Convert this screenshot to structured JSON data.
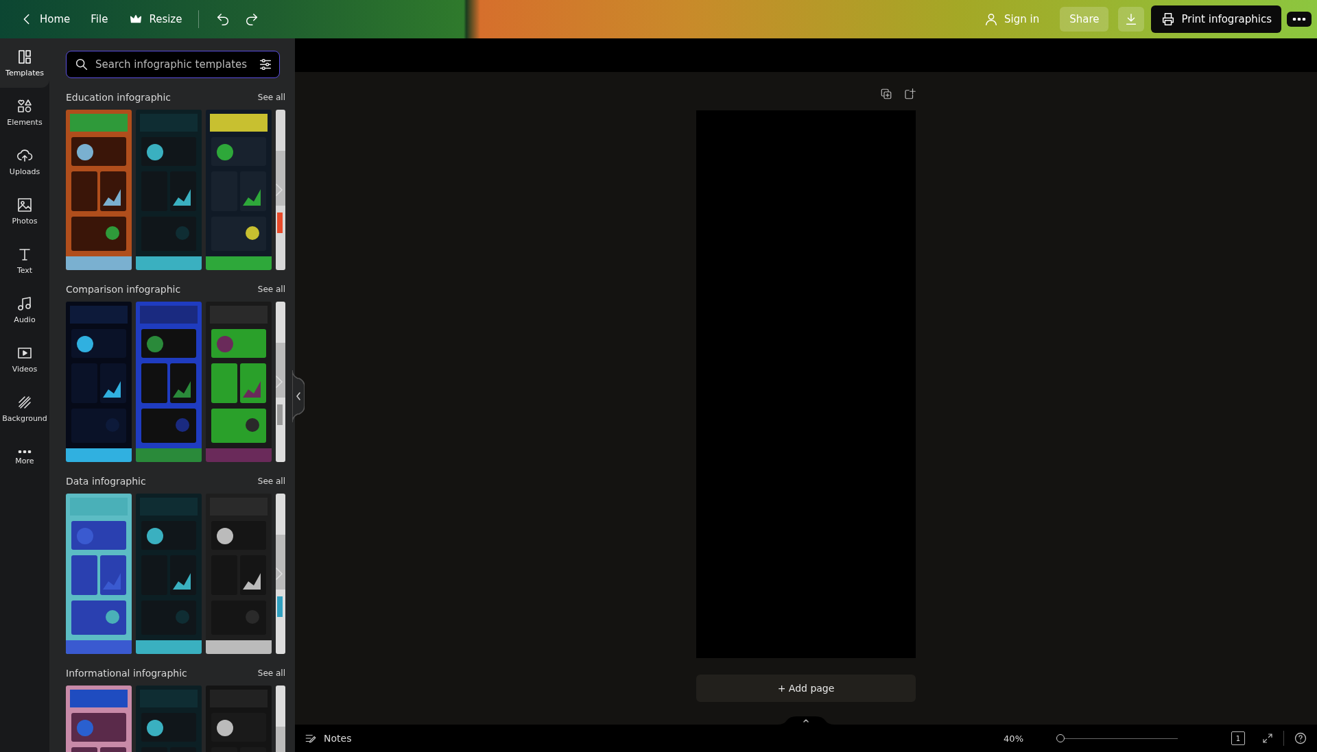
{
  "top_bar": {
    "home": "Home",
    "file": "File",
    "resize": "Resize",
    "sign_in": "Sign in",
    "share": "Share",
    "print": "Print infographics"
  },
  "side_rail": {
    "items": [
      {
        "label": "Templates",
        "selected": true
      },
      {
        "label": "Elements",
        "selected": false
      },
      {
        "label": "Uploads",
        "selected": false
      },
      {
        "label": "Photos",
        "selected": false
      },
      {
        "label": "Text",
        "selected": false
      },
      {
        "label": "Audio",
        "selected": false
      },
      {
        "label": "Videos",
        "selected": false
      },
      {
        "label": "Background",
        "selected": false
      },
      {
        "label": "More",
        "selected": false
      }
    ]
  },
  "panel": {
    "search": {
      "placeholder": "Search infographic templates"
    },
    "sections": [
      {
        "title": "Education infographic",
        "see_all": "See all"
      },
      {
        "title": "Comparison infographic",
        "see_all": "See all"
      },
      {
        "title": "Data infographic",
        "see_all": "See all"
      },
      {
        "title": "Informational infographic",
        "see_all": "See all"
      }
    ]
  },
  "canvas": {
    "add_page": "+ Add page"
  },
  "bottom_bar": {
    "notes": "Notes",
    "zoom": "40%",
    "zoom_slider": {
      "level": 0.02
    },
    "page_count": "1"
  }
}
